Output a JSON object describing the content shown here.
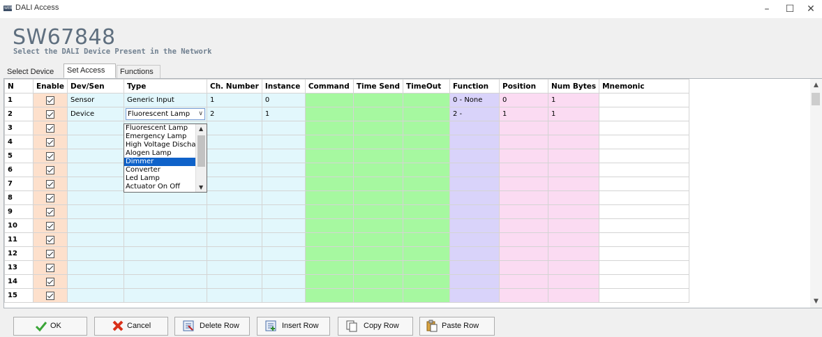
{
  "window": {
    "title": "DALI Access",
    "icon_label": "WEB",
    "min_glyph": "–",
    "max_glyph": "☐",
    "close_glyph": "✕"
  },
  "header": {
    "title": "SW67848",
    "subtitle": "Select the DALI Device Present in the Network"
  },
  "tabs": [
    {
      "label": "Select Device",
      "active": false
    },
    {
      "label": "Set Access",
      "active": true
    },
    {
      "label": "Functions",
      "active": false
    }
  ],
  "columns": [
    "N",
    "Enable",
    "Dev/Sen",
    "Type",
    "Ch. Number",
    "Instance",
    "Command",
    "Time Send",
    "TimeOut",
    "Function",
    "Position",
    "Num Bytes",
    "Mnemonic"
  ],
  "rows": [
    {
      "n": "1",
      "enabled": true,
      "dev_sen": "Sensor",
      "type": "Generic Input",
      "ch_number": "1",
      "instance": "0",
      "command": "",
      "time_send": "",
      "timeout": "",
      "function": "0 - None",
      "position": "0",
      "num_bytes": "1",
      "mnemonic": ""
    },
    {
      "n": "2",
      "enabled": true,
      "dev_sen": "Device",
      "type": "Fluorescent Lamp",
      "ch_number": "2",
      "instance": "1",
      "command": "",
      "time_send": "",
      "timeout": "",
      "function": "2 -",
      "position": "1",
      "num_bytes": "1",
      "mnemonic": ""
    },
    {
      "n": "3",
      "enabled": true
    },
    {
      "n": "4",
      "enabled": true
    },
    {
      "n": "5",
      "enabled": true
    },
    {
      "n": "6",
      "enabled": true
    },
    {
      "n": "7",
      "enabled": true
    },
    {
      "n": "8",
      "enabled": true
    },
    {
      "n": "9",
      "enabled": true
    },
    {
      "n": "10",
      "enabled": true
    },
    {
      "n": "11",
      "enabled": true
    },
    {
      "n": "12",
      "enabled": true
    },
    {
      "n": "13",
      "enabled": true
    },
    {
      "n": "14",
      "enabled": true
    },
    {
      "n": "15",
      "enabled": true
    }
  ],
  "type_dropdown": {
    "options": [
      "Fluorescent Lamp",
      "Emergency Lamp",
      "High Voltage Dischar",
      "Alogen Lamp",
      "Dimmer",
      "Converter",
      "Led Lamp",
      "Actuator On Off"
    ],
    "highlighted": "Dimmer"
  },
  "toolbar": {
    "ok": "OK",
    "cancel": "Cancel",
    "delete_row": "Delete Row",
    "insert_row": "Insert Row",
    "copy_row": "Copy Row",
    "paste_row": "Paste Row"
  },
  "colors": {
    "enable_column": "#fde0cc",
    "info_columns": "#e2f7fc",
    "timing_columns": "#a6f8a0",
    "function_column": "#d9d3fa",
    "position_columns": "#fbdbf2",
    "selection": "#0f62c9"
  }
}
